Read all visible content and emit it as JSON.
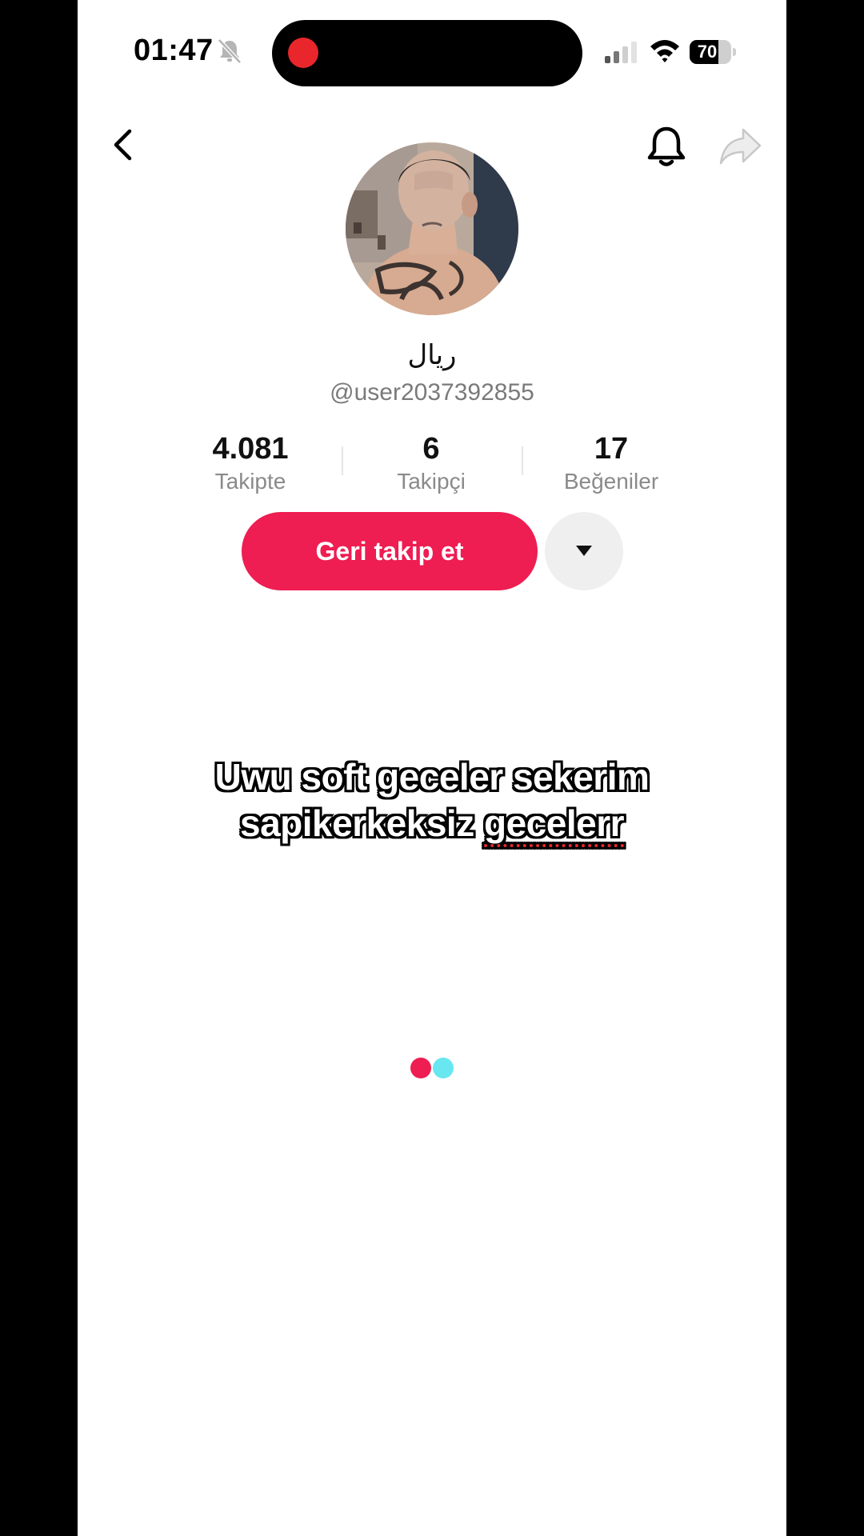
{
  "status_bar": {
    "time": "01:47",
    "battery_level": "70",
    "battery_percent": 70,
    "icons": [
      "silent-mode-icon",
      "recording-indicator",
      "cellular-signal-icon",
      "wifi-icon",
      "battery-icon"
    ]
  },
  "nav": {
    "icons": [
      "back-arrow-icon",
      "bell-icon",
      "share-arrow-icon"
    ]
  },
  "profile": {
    "display_name": "ريال",
    "username": "@user2037392855",
    "stats": [
      {
        "value": "4.081",
        "label": "Takipte"
      },
      {
        "value": "6",
        "label": "Takipçi"
      },
      {
        "value": "17",
        "label": "Beğeniler"
      }
    ],
    "follow_back_label": "Geri takip et"
  },
  "caption": {
    "line1": "Uwu soft geceler sekerim",
    "line2_prefix": "sapikerkeksiz ",
    "line2_flagged": "gecelerr"
  },
  "colors": {
    "accent": "#ee1d52",
    "loader_pink": "#ee1d52",
    "loader_cyan": "#69e7f0"
  }
}
